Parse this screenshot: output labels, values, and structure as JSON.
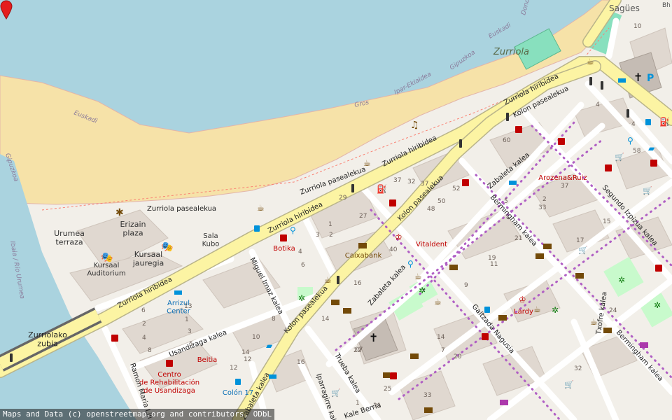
{
  "map": {
    "colors": {
      "water": "#aad3df",
      "beach": "#f6e2a8",
      "land": "#f2efe9",
      "block": "#d9d0c9",
      "primary_road": "#fcf4a3",
      "road": "#ffffff",
      "park": "#c8facc",
      "pitch": "#88e0be",
      "text": "#222222",
      "amenity_red": "#c00000",
      "poi_brown": "#734a08",
      "poi_blue": "#0092da",
      "marker": "#e41d1d"
    },
    "water_labels": [
      "Euskadi",
      "Gros",
      "Ipar-Eklaldea",
      "Gipuzkoa",
      "Euskadi",
      "Donostia",
      "Ibaia / Río Urumea",
      "Gipuzkoa"
    ],
    "place_labels": {
      "zurriola": "Zurriola",
      "sagues": "Sagües",
      "bh": "Bh",
      "erizain_plaza": "Erizain\nplaza",
      "urumea_terraza": "Urumea\nterraza",
      "kursaal_jauregia": "Kursaal\njauregia",
      "kursaal_auditorium": "Kursaal\nAuditorium",
      "sala_kubo": "Sala\nKubo",
      "arrizul_center": "Arrizul\nCenter",
      "colon17": "Colón 17",
      "zurriolako_zubia": "Zurriolako\nzubia",
      "centro_rehab": "Centro\nde Rehabilitación\nde Usandizaga"
    },
    "street_labels": [
      "Zurriola pasealekua",
      "Zurriola pasealekua",
      "Zurriola hiribidea",
      "Zurriola hiribidea",
      "Zurriola hiribidea",
      "Zurriola hiribidea",
      "Kolon pasealekua",
      "Kolon pasealekua",
      "Kolon pasealekua",
      "Zabaleta kalea",
      "Zabaleta kalea",
      "Zabaleta kalea",
      "Bermingham kalea",
      "Bermingham kalea",
      "Segundo Izpizua kalea",
      "Miguel Imaz kalea",
      "Usandizaga kalea",
      "Trueba kalea",
      "Iparragirre kalea",
      "Ramon Maria Lili",
      "Gaitzada Nagusia",
      "Txofre kalea",
      "Kale Berria"
    ],
    "poi_labels": {
      "botika": "Botika",
      "caixabank": "Caixabank",
      "vitaldent": "Vitaldent",
      "arozena": "Arozena&Ruiz",
      "lardy": "Lardy",
      "beitia": "Beitia"
    },
    "house_numbers": [
      "10",
      "60",
      "4",
      "58",
      "37",
      "32",
      "37",
      "52",
      "50",
      "48",
      "5",
      "33",
      "37",
      "2",
      "4",
      "29",
      "27",
      "40",
      "19",
      "21",
      "17",
      "15",
      "1",
      "3",
      "2",
      "4",
      "6",
      "8",
      "10",
      "12",
      "14",
      "16",
      "20",
      "24",
      "32",
      "22",
      "25",
      "31",
      "33",
      "7",
      "9",
      "11",
      "13",
      "1",
      "3",
      "5",
      "6",
      "2",
      "4",
      "8",
      "12",
      "14",
      "16",
      "1",
      "07",
      "14"
    ],
    "attribution": "Maps and Data (c) openstreetmap.org and contributors, ODbL"
  }
}
